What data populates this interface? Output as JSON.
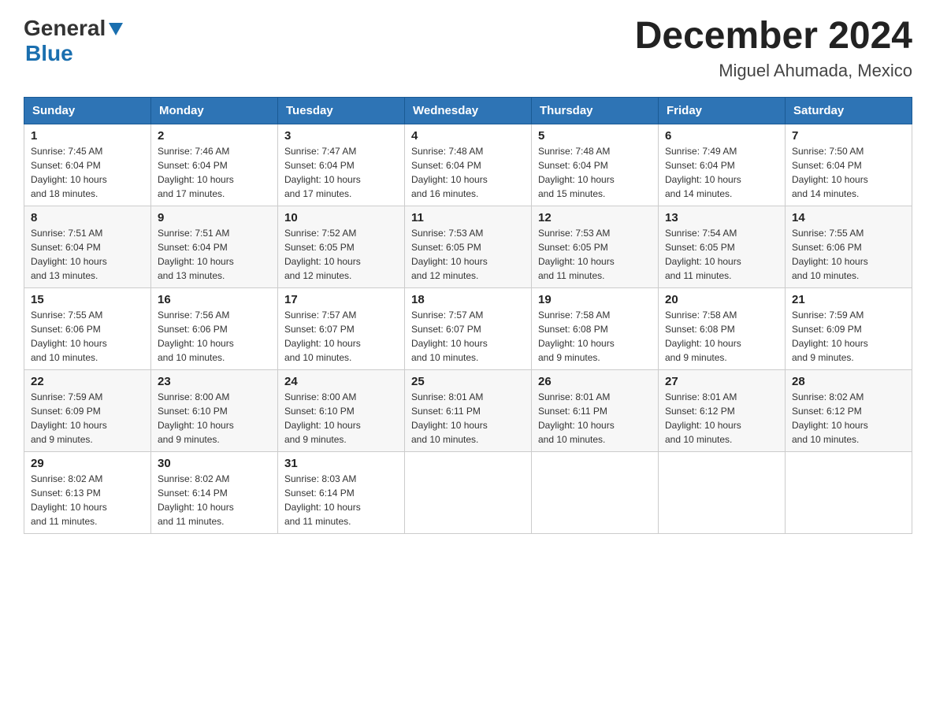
{
  "header": {
    "logo_general": "General",
    "logo_blue": "Blue",
    "month_title": "December 2024",
    "location": "Miguel Ahumada, Mexico"
  },
  "weekdays": [
    "Sunday",
    "Monday",
    "Tuesday",
    "Wednesday",
    "Thursday",
    "Friday",
    "Saturday"
  ],
  "weeks": [
    [
      {
        "day": "1",
        "sunrise": "7:45 AM",
        "sunset": "6:04 PM",
        "daylight": "10 hours and 18 minutes."
      },
      {
        "day": "2",
        "sunrise": "7:46 AM",
        "sunset": "6:04 PM",
        "daylight": "10 hours and 17 minutes."
      },
      {
        "day": "3",
        "sunrise": "7:47 AM",
        "sunset": "6:04 PM",
        "daylight": "10 hours and 17 minutes."
      },
      {
        "day": "4",
        "sunrise": "7:48 AM",
        "sunset": "6:04 PM",
        "daylight": "10 hours and 16 minutes."
      },
      {
        "day": "5",
        "sunrise": "7:48 AM",
        "sunset": "6:04 PM",
        "daylight": "10 hours and 15 minutes."
      },
      {
        "day": "6",
        "sunrise": "7:49 AM",
        "sunset": "6:04 PM",
        "daylight": "10 hours and 14 minutes."
      },
      {
        "day": "7",
        "sunrise": "7:50 AM",
        "sunset": "6:04 PM",
        "daylight": "10 hours and 14 minutes."
      }
    ],
    [
      {
        "day": "8",
        "sunrise": "7:51 AM",
        "sunset": "6:04 PM",
        "daylight": "10 hours and 13 minutes."
      },
      {
        "day": "9",
        "sunrise": "7:51 AM",
        "sunset": "6:04 PM",
        "daylight": "10 hours and 13 minutes."
      },
      {
        "day": "10",
        "sunrise": "7:52 AM",
        "sunset": "6:05 PM",
        "daylight": "10 hours and 12 minutes."
      },
      {
        "day": "11",
        "sunrise": "7:53 AM",
        "sunset": "6:05 PM",
        "daylight": "10 hours and 12 minutes."
      },
      {
        "day": "12",
        "sunrise": "7:53 AM",
        "sunset": "6:05 PM",
        "daylight": "10 hours and 11 minutes."
      },
      {
        "day": "13",
        "sunrise": "7:54 AM",
        "sunset": "6:05 PM",
        "daylight": "10 hours and 11 minutes."
      },
      {
        "day": "14",
        "sunrise": "7:55 AM",
        "sunset": "6:06 PM",
        "daylight": "10 hours and 10 minutes."
      }
    ],
    [
      {
        "day": "15",
        "sunrise": "7:55 AM",
        "sunset": "6:06 PM",
        "daylight": "10 hours and 10 minutes."
      },
      {
        "day": "16",
        "sunrise": "7:56 AM",
        "sunset": "6:06 PM",
        "daylight": "10 hours and 10 minutes."
      },
      {
        "day": "17",
        "sunrise": "7:57 AM",
        "sunset": "6:07 PM",
        "daylight": "10 hours and 10 minutes."
      },
      {
        "day": "18",
        "sunrise": "7:57 AM",
        "sunset": "6:07 PM",
        "daylight": "10 hours and 10 minutes."
      },
      {
        "day": "19",
        "sunrise": "7:58 AM",
        "sunset": "6:08 PM",
        "daylight": "10 hours and 9 minutes."
      },
      {
        "day": "20",
        "sunrise": "7:58 AM",
        "sunset": "6:08 PM",
        "daylight": "10 hours and 9 minutes."
      },
      {
        "day": "21",
        "sunrise": "7:59 AM",
        "sunset": "6:09 PM",
        "daylight": "10 hours and 9 minutes."
      }
    ],
    [
      {
        "day": "22",
        "sunrise": "7:59 AM",
        "sunset": "6:09 PM",
        "daylight": "10 hours and 9 minutes."
      },
      {
        "day": "23",
        "sunrise": "8:00 AM",
        "sunset": "6:10 PM",
        "daylight": "10 hours and 9 minutes."
      },
      {
        "day": "24",
        "sunrise": "8:00 AM",
        "sunset": "6:10 PM",
        "daylight": "10 hours and 9 minutes."
      },
      {
        "day": "25",
        "sunrise": "8:01 AM",
        "sunset": "6:11 PM",
        "daylight": "10 hours and 10 minutes."
      },
      {
        "day": "26",
        "sunrise": "8:01 AM",
        "sunset": "6:11 PM",
        "daylight": "10 hours and 10 minutes."
      },
      {
        "day": "27",
        "sunrise": "8:01 AM",
        "sunset": "6:12 PM",
        "daylight": "10 hours and 10 minutes."
      },
      {
        "day": "28",
        "sunrise": "8:02 AM",
        "sunset": "6:12 PM",
        "daylight": "10 hours and 10 minutes."
      }
    ],
    [
      {
        "day": "29",
        "sunrise": "8:02 AM",
        "sunset": "6:13 PM",
        "daylight": "10 hours and 11 minutes."
      },
      {
        "day": "30",
        "sunrise": "8:02 AM",
        "sunset": "6:14 PM",
        "daylight": "10 hours and 11 minutes."
      },
      {
        "day": "31",
        "sunrise": "8:03 AM",
        "sunset": "6:14 PM",
        "daylight": "10 hours and 11 minutes."
      },
      null,
      null,
      null,
      null
    ]
  ],
  "labels": {
    "sunrise": "Sunrise:",
    "sunset": "Sunset:",
    "daylight": "Daylight:"
  }
}
